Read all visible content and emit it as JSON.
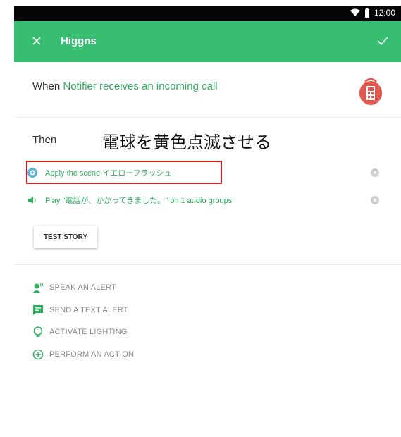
{
  "status_bar": {
    "time": "12:00"
  },
  "app_bar": {
    "title": "Higgns"
  },
  "when": {
    "prefix": "When",
    "trigger": "Notifier receives an incoming call"
  },
  "then": {
    "label": "Then"
  },
  "annotation": {
    "text": "電球を黄色点滅させる",
    "color": "#e02020"
  },
  "actions": [
    {
      "text": "Apply the scene イエローフラッシュ",
      "icon": "lighting-scene-icon"
    },
    {
      "text": "Play \"電話が、かかってきました。\" on 1 audio groups",
      "icon": "speaker-icon"
    }
  ],
  "test_button": {
    "label": "TEST STORY"
  },
  "add_options": [
    {
      "label": "SPEAK AN ALERT",
      "icon": "speak-alert-icon"
    },
    {
      "label": "SEND A TEXT ALERT",
      "icon": "text-alert-icon"
    },
    {
      "label": "ACTIVATE LIGHTING",
      "icon": "lightbulb-icon"
    },
    {
      "label": "PERFORM AN ACTION",
      "icon": "add-circle-icon"
    }
  ],
  "colors": {
    "accent": "#37be71",
    "highlight_text": "#2fae5e",
    "trigger_icon": "#e0584f",
    "annotation_box": "#e02020"
  }
}
